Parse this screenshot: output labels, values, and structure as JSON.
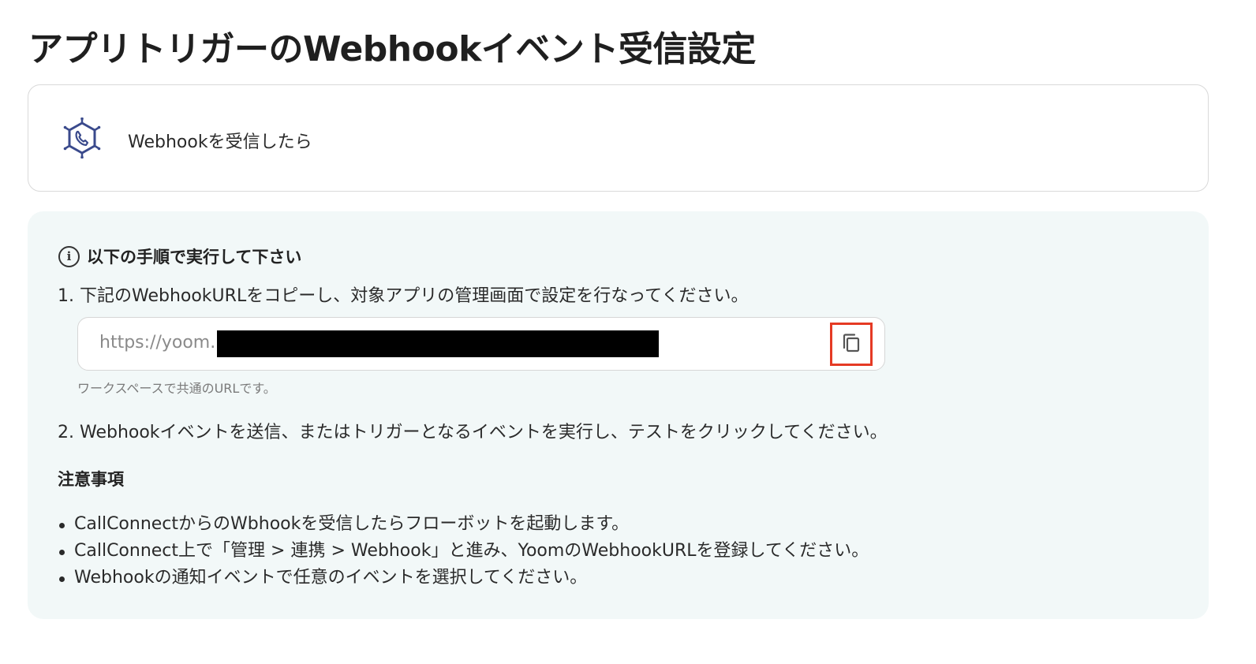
{
  "page": {
    "title": "アプリトリガーのWebhookイベント受信設定"
  },
  "trigger": {
    "icon": "webhook-phone-icon",
    "label": "Webhookを受信したら"
  },
  "instructions": {
    "info_icon": "info-icon",
    "heading": "以下の手順で実行して下さい",
    "step1": "1. 下記のWebhookURLをコピーし、対象アプリの管理画面で設定を行なってください。",
    "url_value": "https://yoom.",
    "url_redacted": true,
    "copy_icon": "copy-icon",
    "url_helper": "ワークスペースで共通のURLです。",
    "step2": "2. Webhookイベントを送信、またはトリガーとなるイベントを実行し、テストをクリックしてください。"
  },
  "notes": {
    "heading": "注意事項",
    "items": [
      "CallConnectからのWbhookを受信したらフローボットを起動します。",
      "CallConnect上で「管理 > 連携 > Webhook」と進み、YoomのWebhookURLを登録してください。",
      "Webhookの通知イベントで任意のイベントを選択してください。"
    ]
  },
  "colors": {
    "panel_background": "#f2f8f8",
    "highlight_border": "#e53a24",
    "icon_accent": "#3a4a8c"
  }
}
